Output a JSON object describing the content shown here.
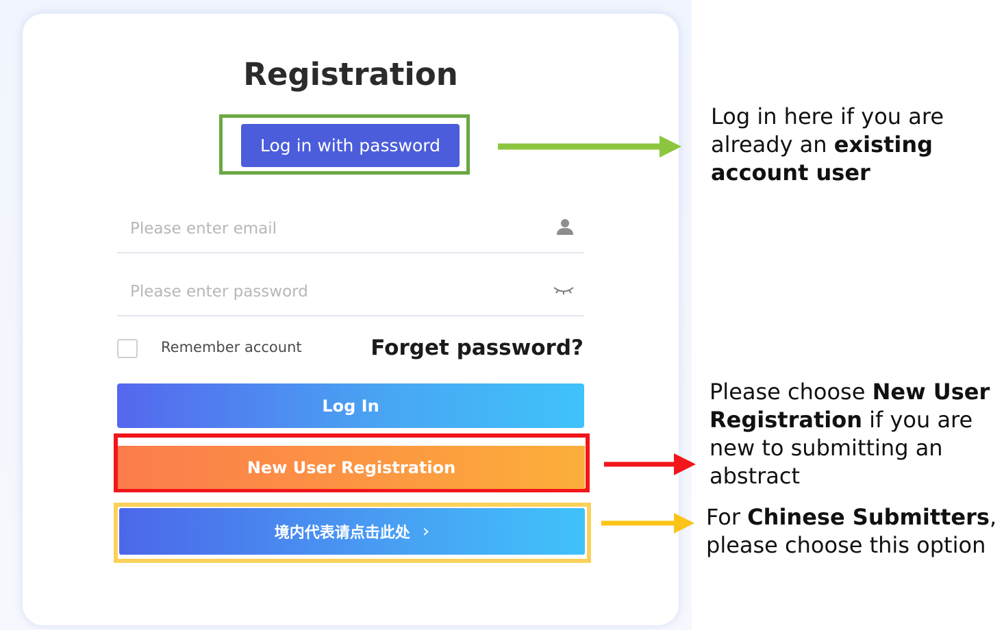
{
  "form": {
    "title": "Registration",
    "login_with_password": "Log in with password",
    "email_placeholder": "Please enter email",
    "password_placeholder": "Please enter password",
    "remember_label": "Remember account",
    "remember_checked": false,
    "forget_link": "Forget password?",
    "login_button": "Log In",
    "new_user_button": "New User Registration",
    "chinese_button": "境内代表请点击此处",
    "chinese_chevron": "›"
  },
  "annotations": {
    "existing": {
      "pre": "Log in here if you are already an ",
      "bold": "existing account user",
      "post": ""
    },
    "new_user": {
      "pre": "Please choose ",
      "bold": "New User Registration",
      "post": " if you are new to submitting an abstract"
    },
    "chinese": {
      "pre": "For ",
      "bold": "Chinese Submitters",
      "post": ", please choose this option"
    }
  },
  "colors": {
    "highlight_green": "#6aa843",
    "highlight_red": "#f2161b",
    "highlight_yellow": "#fcd15a",
    "arrow_green": "#8cc63f",
    "arrow_red": "#f2161b",
    "arrow_yellow": "#fcc419",
    "primary_blue": "#4b5ddb"
  },
  "icons": {
    "email": "user-icon",
    "password": "eye-closed-icon",
    "chevron": "chevron-right-icon"
  }
}
